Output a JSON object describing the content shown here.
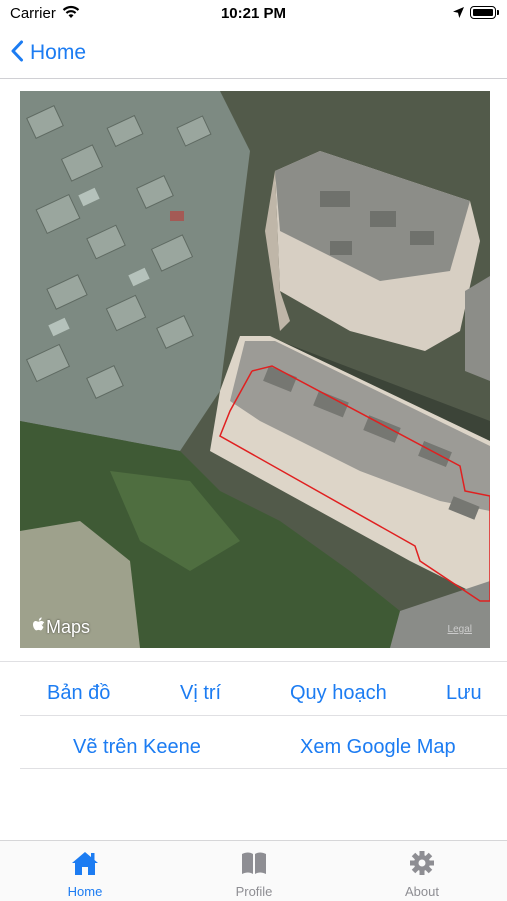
{
  "status_bar": {
    "carrier": "Carrier",
    "time": "10:21 PM"
  },
  "nav": {
    "back_label": "Home"
  },
  "map": {
    "logo_text": "Maps",
    "legal": "Legal"
  },
  "actions": {
    "row1": [
      "Bản đồ",
      "Vị trí",
      "Quy hoạch",
      "Lưu"
    ],
    "row2": [
      "Vẽ trên Keene",
      "Xem Google Map"
    ]
  },
  "tabs": [
    {
      "label": "Home",
      "icon": "home-icon",
      "active": true
    },
    {
      "label": "Profile",
      "icon": "book-icon",
      "active": false
    },
    {
      "label": "About",
      "icon": "gear-icon",
      "active": false
    }
  ],
  "colors": {
    "accent": "#1c7cf2",
    "inactive": "#8e8e93",
    "parcel_outline": "#e02020"
  }
}
